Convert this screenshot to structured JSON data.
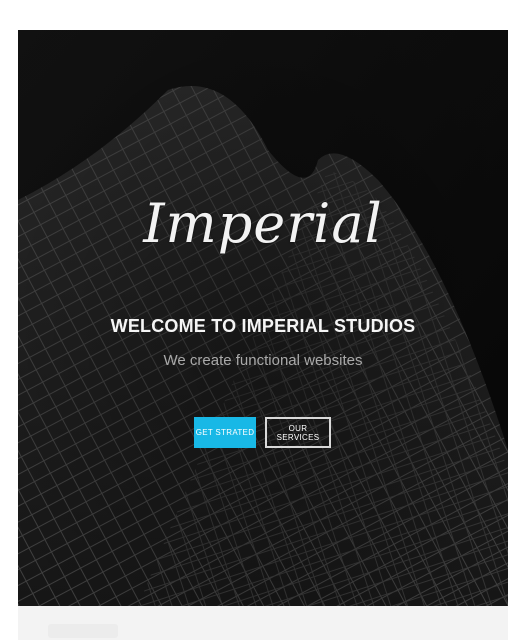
{
  "hero": {
    "logo": "Imperial",
    "headline": "WELCOME TO IMPERIAL STUDIOS",
    "subline": "We create functional websites",
    "buttons": {
      "primary_label": "GET STRATED",
      "secondary_label": "OUR SERVICES"
    },
    "background_image": "dark-skyscraper-photo"
  },
  "colors": {
    "hero_background": "#0c0c0c",
    "accent": "#18b8e6",
    "headline": "#f5f5f5",
    "subline": "#a9a9a9",
    "page_background": "#ffffff",
    "footer_strip": "#f3f3f3"
  }
}
